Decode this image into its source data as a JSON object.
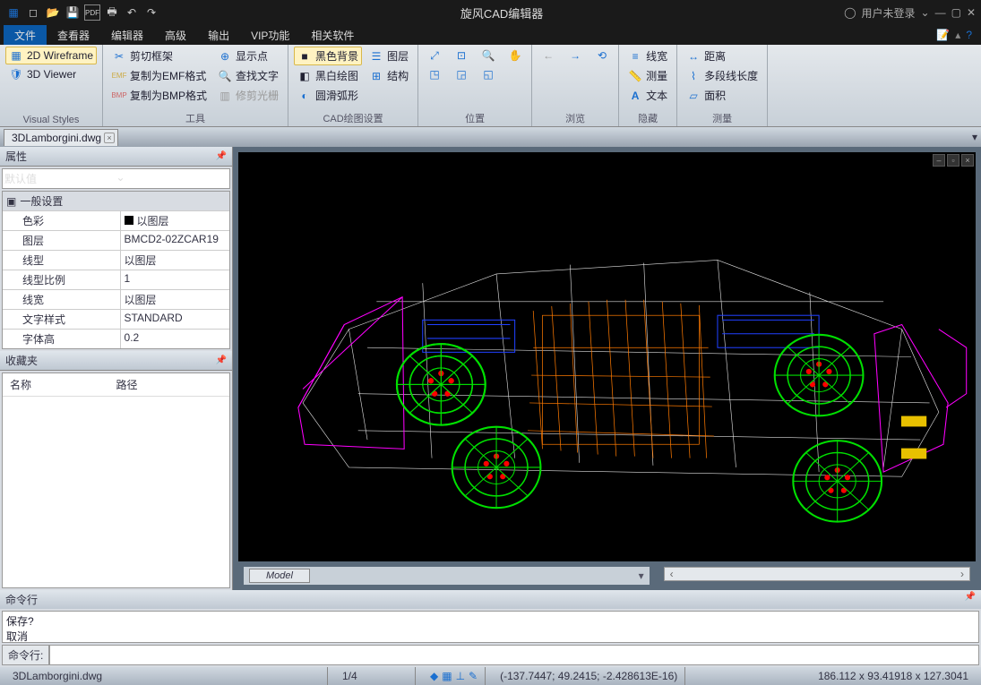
{
  "title": "旋风CAD编辑器",
  "user_status": "用户未登录",
  "menus": [
    "文件",
    "查看器",
    "编辑器",
    "高级",
    "输出",
    "VIP功能",
    "相关软件"
  ],
  "active_menu": "文件",
  "ribbon": {
    "g0": {
      "label": "Visual Styles",
      "b0": "2D Wireframe",
      "b1": "3D Viewer"
    },
    "g1": {
      "label": "工具",
      "b0": "剪切框架",
      "b1": "复制为EMF格式",
      "b2": "复制为BMP格式",
      "b3": "显示点",
      "b4": "查找文字",
      "b5": "修剪光栅"
    },
    "g2": {
      "label": "CAD绘图设置",
      "b0": "黑色背景",
      "b1": "黑白绘图",
      "b2": "圆滑弧形",
      "b3": "图层",
      "b4": "结构"
    },
    "g3": {
      "label": "位置"
    },
    "g4": {
      "label": "浏览"
    },
    "g5": {
      "label": "隐藏",
      "b0": "线宽",
      "b1": "测量",
      "b2": "文本"
    },
    "g6": {
      "label": "测量",
      "b0": "距离",
      "b1": "多段线长度",
      "b2": "面积"
    }
  },
  "doc_tab": "3DLamborgini.dwg",
  "props": {
    "title": "属性",
    "default": "默认值",
    "section": "一般设置",
    "rows": [
      {
        "k": "色彩",
        "v": "以图层"
      },
      {
        "k": "图层",
        "v": "BMCD2-02ZCAR19"
      },
      {
        "k": "线型",
        "v": "以图层"
      },
      {
        "k": "线型比例",
        "v": "1"
      },
      {
        "k": "线宽",
        "v": "以图层"
      },
      {
        "k": "文字样式",
        "v": "STANDARD"
      },
      {
        "k": "字体高",
        "v": "0.2"
      }
    ]
  },
  "fav": {
    "title": "收藏夹",
    "col0": "名称",
    "col1": "路径"
  },
  "model_tab": "Model",
  "cmd": {
    "title": "命令行",
    "log0": "保存?",
    "log1": "取消",
    "label": "命令行:"
  },
  "status": {
    "file": "3DLamborgini.dwg",
    "page": "1/4",
    "coords": "(-137.7447; 49.2415; -2.428613E-16)",
    "dims": "186.112 x 93.41918 x 127.3041"
  }
}
